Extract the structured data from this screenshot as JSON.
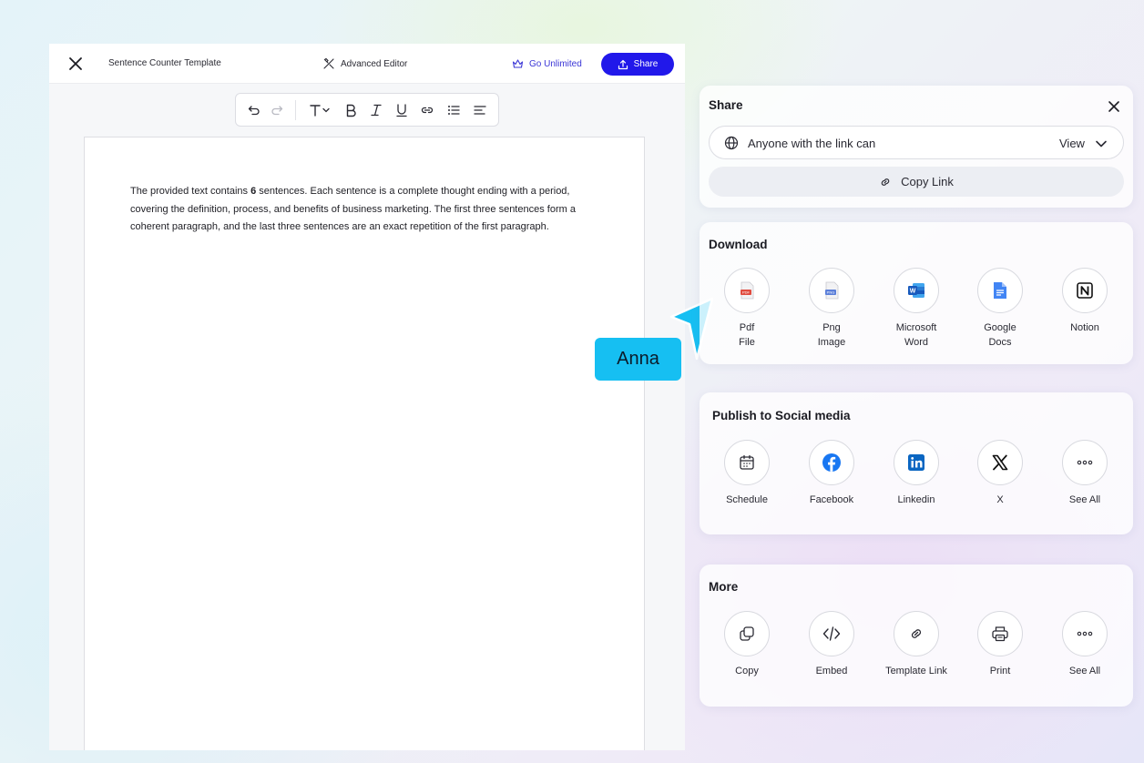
{
  "editor": {
    "doc_title": "Sentence Counter Template",
    "advanced_editor": "Advanced Editor",
    "go_unlimited": "Go Unlimited",
    "share": "Share",
    "body_pre": "The provided text contains ",
    "body_count": "6",
    "body_post": " sentences. Each sentence is a complete thought ending with a period, covering the definition, process, and benefits of business marketing. The first three sentences form a coherent paragraph, and the last three sentences are an exact repetition of the first paragraph."
  },
  "cursor": {
    "name": "Anna",
    "color": "#16bff2"
  },
  "share_panel": {
    "title": "Share",
    "access_label": "Anyone with the link can",
    "permission": "View",
    "copy_link": "Copy Link"
  },
  "download": {
    "title": "Download",
    "items": [
      {
        "icon": "pdf-file-icon",
        "line1": "Pdf",
        "line2": "File"
      },
      {
        "icon": "png-image-icon",
        "line1": "Png",
        "line2": "Image"
      },
      {
        "icon": "microsoft-word-icon",
        "line1": "Microsoft",
        "line2": "Word"
      },
      {
        "icon": "google-docs-icon",
        "line1": "Google",
        "line2": "Docs"
      },
      {
        "icon": "notion-icon",
        "line1": "Notion",
        "line2": ""
      }
    ]
  },
  "social": {
    "title": "Publish to Social media",
    "items": [
      {
        "icon": "calendar-icon",
        "label": "Schedule"
      },
      {
        "icon": "facebook-icon",
        "label": "Facebook"
      },
      {
        "icon": "linkedin-icon",
        "label": "Linkedin"
      },
      {
        "icon": "x-icon",
        "label": "X"
      },
      {
        "icon": "more-dots-icon",
        "label": "See All"
      }
    ]
  },
  "more": {
    "title": "More",
    "items": [
      {
        "icon": "copy-icon",
        "label": "Copy"
      },
      {
        "icon": "embed-code-icon",
        "label": "Embed"
      },
      {
        "icon": "link-icon",
        "label": "Template Link"
      },
      {
        "icon": "printer-icon",
        "label": "Print"
      },
      {
        "icon": "more-dots-icon",
        "label": "See All"
      }
    ]
  },
  "colors": {
    "primary": "#2118ea",
    "go_unlimited": "#3a35d6",
    "facebook": "#1877f2",
    "linkedin": "#0a66c2",
    "word": "#185abd",
    "google_docs": "#4285f4",
    "pdf": "#e04b3f"
  }
}
